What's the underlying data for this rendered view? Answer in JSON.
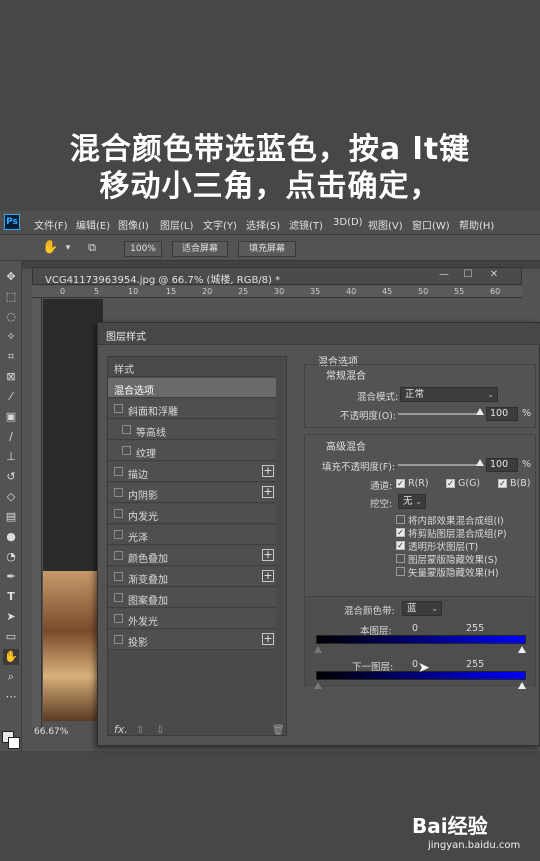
{
  "caption": {
    "line1": "混合颜色带选蓝色，按a lt键",
    "line2": "移动小三角，点击确定，"
  },
  "menubar": {
    "logo": "Ps",
    "items": [
      "文件(F)",
      "编辑(E)",
      "图像(I)",
      "图层(L)",
      "文字(Y)",
      "选择(S)",
      "滤镜(T)",
      "3D(D)",
      "视图(V)",
      "窗口(W)",
      "帮助(H)"
    ]
  },
  "options": {
    "zoom_100": "100%",
    "fit_screen": "适合屏幕",
    "fill_screen": "填充屏幕"
  },
  "document": {
    "title": "VCG41173963954.jpg @ 66.7% (城楼, RGB/8) *",
    "zoom_status": "66.67%",
    "ruler_numbers": [
      "0",
      "5",
      "10",
      "15",
      "20",
      "25",
      "30",
      "35",
      "40",
      "45",
      "50",
      "55",
      "60"
    ]
  },
  "dialog": {
    "title": "图层样式",
    "left_items": [
      {
        "label": "样式",
        "type": "header"
      },
      {
        "label": "混合选项",
        "type": "selected"
      },
      {
        "label": "斜面和浮雕",
        "checkbox": true
      },
      {
        "label": "等高线",
        "checkbox": true,
        "indent": true
      },
      {
        "label": "纹理",
        "checkbox": true,
        "indent": true
      },
      {
        "label": "描边",
        "checkbox": true,
        "plus": true
      },
      {
        "label": "内阴影",
        "checkbox": true,
        "plus": true
      },
      {
        "label": "内发光",
        "checkbox": true
      },
      {
        "label": "光泽",
        "checkbox": true
      },
      {
        "label": "颜色叠加",
        "checkbox": true,
        "plus": true
      },
      {
        "label": "渐变叠加",
        "checkbox": true,
        "plus": true
      },
      {
        "label": "图案叠加",
        "checkbox": true
      },
      {
        "label": "外发光",
        "checkbox": true
      },
      {
        "label": "投影",
        "checkbox": true,
        "plus": true
      }
    ],
    "footer_fx": "fx.",
    "blend_options": "混合选项",
    "general_blending": "常规混合",
    "blend_mode_label": "混合模式:",
    "blend_mode_value": "正常",
    "opacity_label": "不透明度(O):",
    "opacity_value": "100",
    "percent": "%",
    "advanced_blending": "高级混合",
    "fill_opacity_label": "填充不透明度(F):",
    "fill_opacity_value": "100",
    "channels_label": "通道:",
    "channel_r": "R(R)",
    "channel_g": "G(G)",
    "channel_b": "B(B)",
    "knockout_label": "挖空:",
    "knockout_value": "无",
    "options_list": [
      {
        "label": "将内部效果混合成组(I)",
        "checked": false
      },
      {
        "label": "将剪贴图层混合成组(P)",
        "checked": true
      },
      {
        "label": "透明形状图层(T)",
        "checked": true
      },
      {
        "label": "图层蒙版隐藏效果(S)",
        "checked": false
      },
      {
        "label": "矢量蒙版隐藏效果(H)",
        "checked": false
      }
    ],
    "blend_if_label": "混合颜色带:",
    "blend_if_value": "蓝",
    "this_layer_label": "本图层:",
    "this_layer_min": "0",
    "this_layer_max": "255",
    "underlying_label": "下一图层:",
    "underlying_min": "0",
    "underlying_max": "255"
  },
  "watermark": {
    "logo": "Bai经验",
    "url": "jingyan.baidu.com"
  },
  "colors": {
    "accent_blue": "#0000ff",
    "ps_blue": "#31a8ff"
  }
}
